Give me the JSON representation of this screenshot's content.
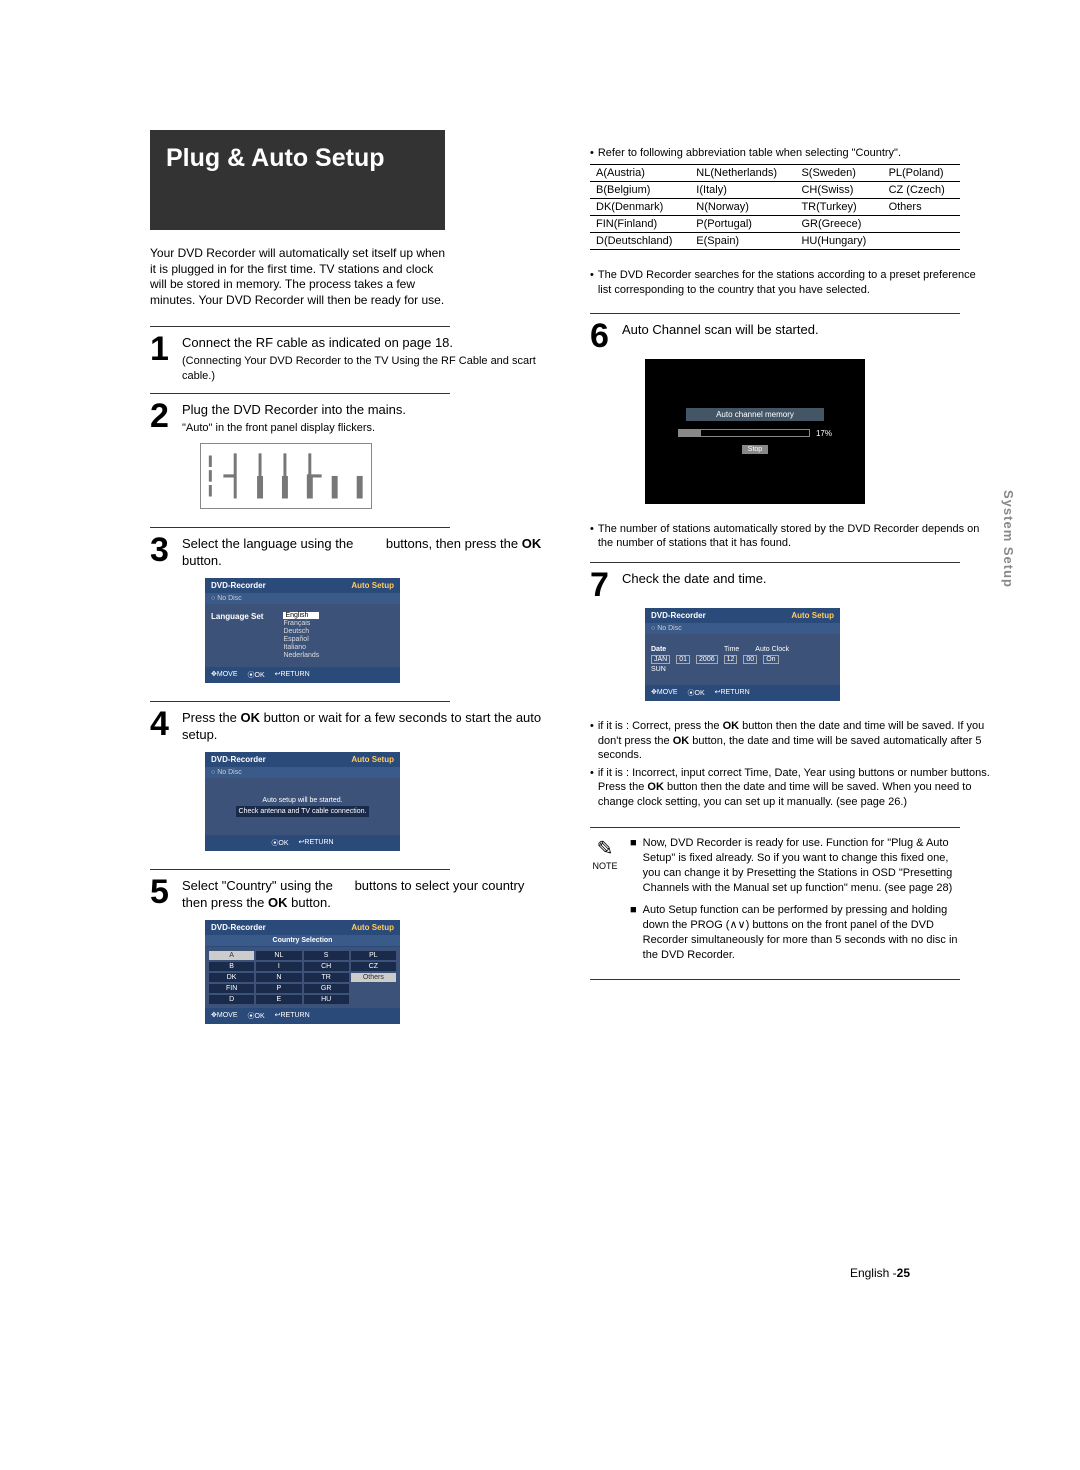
{
  "hero_title": "Plug & Auto Setup",
  "intro": "Your DVD Recorder will automatically set itself up when it is plugged in for the first time. TV stations and clock will be stored in memory. The process takes a few minutes. Your DVD Recorder will then be ready for use.",
  "steps": {
    "s1_num": "1",
    "s1_text": "Connect the RF cable as indicated on page 18.",
    "s1_sub": "(Connecting Your DVD Recorder to the TV Using the RF Cable and scart cable.)",
    "s2_num": "2",
    "s2_text": "Plug the DVD Recorder into the mains.",
    "s2_sub": "\"Auto\" in the front panel display flickers.",
    "s3_num": "3",
    "s3_text_a": "Select the language using the",
    "s3_text_b": "buttons, then press the ",
    "s3_ok": "OK",
    "s3_text_c": " button.",
    "s4_num": "4",
    "s4_text_a": "Press the ",
    "s4_ok": "OK",
    "s4_text_b": " button or wait for a few seconds to start the auto setup.",
    "s5_num": "5",
    "s5_text_a": "Select \"Country\" using the",
    "s5_text_b": "buttons to select your country then press the ",
    "s5_ok": "OK",
    "s5_text_c": " button.",
    "s6_num": "6",
    "s6_text": "Auto Channel scan will be started.",
    "s7_num": "7",
    "s7_text": "Check the date and time."
  },
  "front_display": "A U E O",
  "osd_common": {
    "dvd": "DVD-Recorder",
    "autosetup": "Auto Setup",
    "nodisc": "No Disc",
    "move": "MOVE",
    "ok": "OK",
    "return": "RETURN"
  },
  "osd_lang": {
    "label": "Language Set",
    "items": [
      "English",
      "Français",
      "Deutsch",
      "Español",
      "Italiano",
      "Nederlands"
    ]
  },
  "osd_autostart": {
    "line1": "Auto setup will be started.",
    "line2": "Check antenna and TV cable connection."
  },
  "osd_country": {
    "header": "Country Selection",
    "rows": [
      [
        "A",
        "NL",
        "S",
        "PL"
      ],
      [
        "B",
        "I",
        "CH",
        "CZ"
      ],
      [
        "DK",
        "N",
        "TR",
        "Others"
      ],
      [
        "FIN",
        "P",
        "GR",
        ""
      ],
      [
        "D",
        "E",
        "HU",
        ""
      ]
    ]
  },
  "right_intro": "Refer to following abbreviation table when selecting \"Country\".",
  "country_table": [
    [
      "A(Austria)",
      "NL(Netherlands)",
      "S(Sweden)",
      "PL(Poland)"
    ],
    [
      "B(Belgium)",
      "I(Italy)",
      "CH(Swiss)",
      "CZ (Czech)"
    ],
    [
      "DK(Denmark)",
      "N(Norway)",
      "TR(Turkey)",
      "Others"
    ],
    [
      "FIN(Finland)",
      "P(Portugal)",
      "GR(Greece)",
      ""
    ],
    [
      "D(Deutschland)",
      "E(Spain)",
      "HU(Hungary)",
      ""
    ]
  ],
  "right_bullet1": "The DVD Recorder searches for the stations according to a preset preference list corresponding to the country that you have selected.",
  "scan": {
    "header": "Auto channel memory",
    "percent": "17%",
    "stop": "Stop"
  },
  "right_bullet2": "The number of stations automatically stored by the DVD Recorder depends on the number of stations that it has found.",
  "osd_date": {
    "date_lbl": "Date",
    "time_lbl": "Time",
    "clock_lbl": "Auto Clock",
    "month": "JAN",
    "day": "01",
    "year": "2006",
    "hr": "12",
    "min": "00",
    "ac": "On",
    "dow": "SUN"
  },
  "check_correct_a": "if it is : Correct, press the ",
  "check_correct_b": " button then the date and time will be saved. If you don't press the ",
  "check_correct_c": " button, the date and time will be saved automatically after 5 seconds.",
  "check_incorrect_a": "if it is : Incorrect, input correct Time, Date, Year using",
  "check_incorrect_b": "buttons or number buttons. Press the ",
  "check_incorrect_c": " button then the date and time will be saved. When you need to change clock setting, you can set up it manually. (see page 26.)",
  "note_label": "NOTE",
  "note1": "Now, DVD Recorder is ready for use. Function for \"Plug & Auto Setup\" is fixed already. So if you want to change this fixed one, you can change it by Presetting the Stations in OSD \"Presetting Channels with the Manual set up function\" menu. (see page 28)",
  "note2_a": "Auto Setup function can be performed by pressing and holding down the PROG (",
  "note2_b": ") buttons on the front panel of the DVD Recorder simultaneously for more than 5 seconds with no disc in the DVD Recorder.",
  "sidetab": "System Setup",
  "footer_lang": "English -",
  "footer_page": "25",
  "ok_word": "OK"
}
